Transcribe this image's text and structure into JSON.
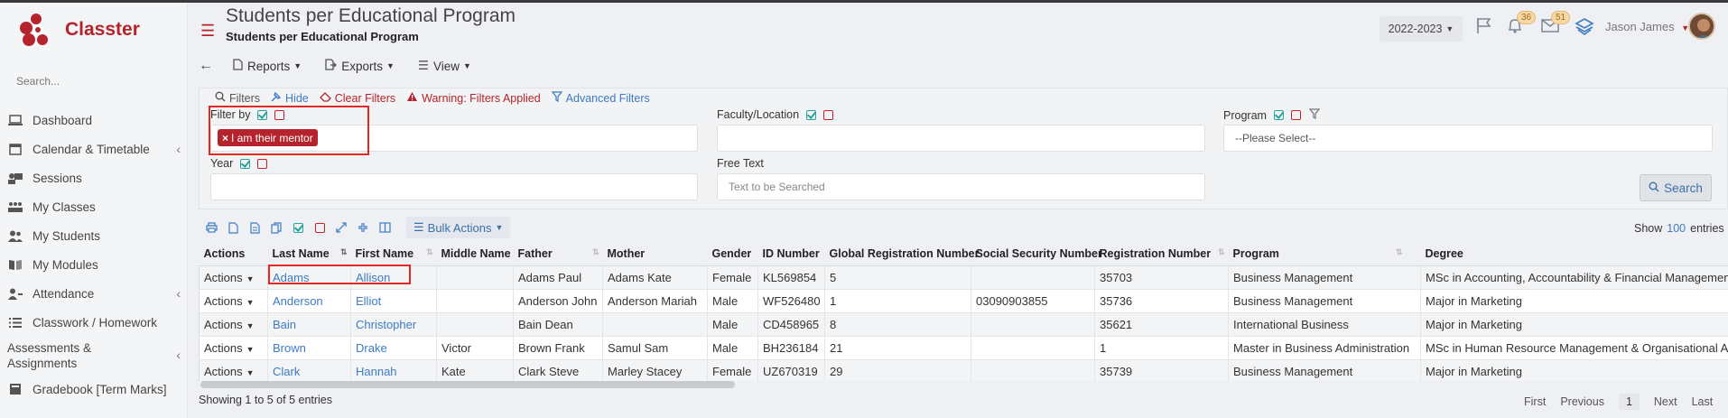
{
  "app": {
    "name": "Classter",
    "brand_color": "#b5242c"
  },
  "sidebar": {
    "search_placeholder": "Search...",
    "items": [
      {
        "label": "Dashboard",
        "icon": "laptop-icon",
        "has_children": false
      },
      {
        "label": "Calendar & Timetable",
        "icon": "calendar-icon",
        "has_children": true
      },
      {
        "label": "Sessions",
        "icon": "presentation-icon",
        "has_children": false
      },
      {
        "label": "My Classes",
        "icon": "classes-icon",
        "has_children": false
      },
      {
        "label": "My Students",
        "icon": "users-icon",
        "has_children": false
      },
      {
        "label": "My Modules",
        "icon": "book-icon",
        "has_children": false
      },
      {
        "label": "Attendance",
        "icon": "user-check-icon",
        "has_children": true
      },
      {
        "label": "Classwork / Homework",
        "icon": "list-icon",
        "has_children": false
      },
      {
        "label": "Assessments & Assignments",
        "icon": "clipboard-icon",
        "has_children": true
      },
      {
        "label": "Gradebook [Term Marks]",
        "icon": "gradebook-icon",
        "has_children": false
      }
    ]
  },
  "header": {
    "title": "Students per Educational Program",
    "subtitle": "Students per Educational Program",
    "year": "2022-2023",
    "notif_count": "36",
    "messages_count": "51",
    "user_name": "Jason James"
  },
  "toolbar": {
    "reports": "Reports",
    "exports": "Exports",
    "view": "View"
  },
  "filters": {
    "tabs": {
      "filters": "Filters",
      "hide": "Hide",
      "clear": "Clear Filters",
      "warning": "Warning: Filters Applied",
      "advanced": "Advanced Filters"
    },
    "filter_by_label": "Filter by",
    "filter_by_tag": "I am their mentor",
    "faculty_label": "Faculty/Location",
    "program_label": "Program",
    "program_placeholder": "--Please Select--",
    "year_label": "Year",
    "free_text_label": "Free Text",
    "free_text_placeholder": "Text to be Searched",
    "search_button": "Search"
  },
  "table_tools": {
    "bulk_actions": "Bulk Actions",
    "show_label": "Show",
    "show_count": "100",
    "entries_label": "entries"
  },
  "table": {
    "columns": [
      "Actions",
      "Last Name",
      "First Name",
      "Middle Name",
      "Father",
      "Mother",
      "Gender",
      "ID Number",
      "Global Registration Number",
      "Social Security Number",
      "Registration Number",
      "Program",
      "Degree"
    ],
    "rows": [
      {
        "actions": "Actions",
        "last": "Adams",
        "first": "Allison",
        "middle": "",
        "father": "Adams Paul",
        "mother": "Adams Kate",
        "gender": "Female",
        "id": "KL569854",
        "global": "5",
        "ssn": "",
        "reg": "35703",
        "program": "Business Management",
        "degree": "MSc in Accounting, Accountability & Financial Management"
      },
      {
        "actions": "Actions",
        "last": "Anderson",
        "first": "Elliot",
        "middle": "",
        "father": "Anderson John",
        "mother": "Anderson Mariah",
        "gender": "Male",
        "id": "WF526480",
        "global": "1",
        "ssn": "03090903855",
        "reg": "35736",
        "program": "Business Management",
        "degree": "Major in Marketing"
      },
      {
        "actions": "Actions",
        "last": "Bain",
        "first": "Christopher",
        "middle": "",
        "father": "Bain Dean",
        "mother": "",
        "gender": "Male",
        "id": "CD458965",
        "global": "8",
        "ssn": "",
        "reg": "35621",
        "program": "International Business",
        "degree": "Major in Marketing"
      },
      {
        "actions": "Actions",
        "last": "Brown",
        "first": "Drake",
        "middle": "Victor",
        "father": "Brown Frank",
        "mother": "Samul Sam",
        "gender": "Male",
        "id": "BH236184",
        "global": "21",
        "ssn": "",
        "reg": "1",
        "program": "Master in Business Administration",
        "degree": "MSc in Human Resource Management & Organisational Analysis"
      },
      {
        "actions": "Actions",
        "last": "Clark",
        "first": "Hannah",
        "middle": "Kate",
        "father": "Clark Steve",
        "mother": "Marley Stacey",
        "gender": "Female",
        "id": "UZ670319",
        "global": "29",
        "ssn": "",
        "reg": "35739",
        "program": "Business Management",
        "degree": "Major in Marketing"
      }
    ]
  },
  "footer": {
    "showing": "Showing 1 to 5 of 5 entries",
    "first": "First",
    "previous": "Previous",
    "page": "1",
    "next": "Next",
    "last": "Last"
  }
}
